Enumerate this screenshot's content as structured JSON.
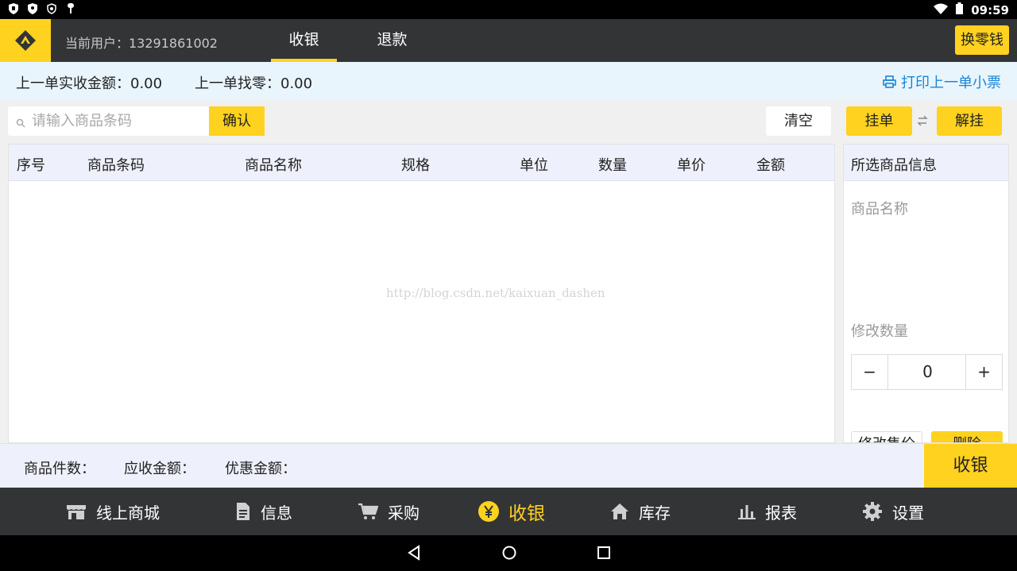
{
  "status_bar": {
    "time": "09:59"
  },
  "header": {
    "current_user": "当前用户：13291861002",
    "tabs": [
      {
        "label": "收银",
        "active": true
      },
      {
        "label": "退款",
        "active": false
      }
    ],
    "change_button": "换零钱"
  },
  "info_bar": {
    "last_received": "上一单实收金额：0.00",
    "last_change": "上一单找零：0.00",
    "print_link": "打印上一单小票"
  },
  "search": {
    "placeholder": "请输入商品条码",
    "value": "",
    "confirm": "确认"
  },
  "actions": {
    "clear": "清空",
    "hold": "挂单",
    "unhold": "解挂"
  },
  "table": {
    "columns": [
      "序号",
      "商品条码",
      "商品名称",
      "规格",
      "单位",
      "数量",
      "单价",
      "金额"
    ],
    "rows": [],
    "watermark": "http://blog.csdn.net/kaixuan_dashen"
  },
  "side_panel": {
    "title": "所选商品信息",
    "name_label": "商品名称",
    "qty_label": "修改数量",
    "minus": "−",
    "plus": "+",
    "qty_value": "0",
    "modify_price": "修改售价",
    "delete": "删除"
  },
  "summary": {
    "item_count": "商品件数：",
    "receivable": "应收金额：",
    "discount": "优惠金额：",
    "checkout": "收银"
  },
  "bottom_nav": [
    {
      "label": "线上商城",
      "icon": "store-icon",
      "active": false
    },
    {
      "label": "信息",
      "icon": "document-icon",
      "active": false
    },
    {
      "label": "采购",
      "icon": "cart-icon",
      "active": false
    },
    {
      "label": "收银",
      "icon": "yen-coin-icon",
      "active": true
    },
    {
      "label": "库存",
      "icon": "home-icon",
      "active": false
    },
    {
      "label": "报表",
      "icon": "bar-chart-icon",
      "active": false
    },
    {
      "label": "设置",
      "icon": "gear-icon",
      "active": false
    }
  ],
  "colors": {
    "accent": "#ffd21f",
    "header_bg": "#333436",
    "info_bg": "#e9f5fd",
    "link": "#1a86d6",
    "table_head_bg": "#eef0fb"
  }
}
